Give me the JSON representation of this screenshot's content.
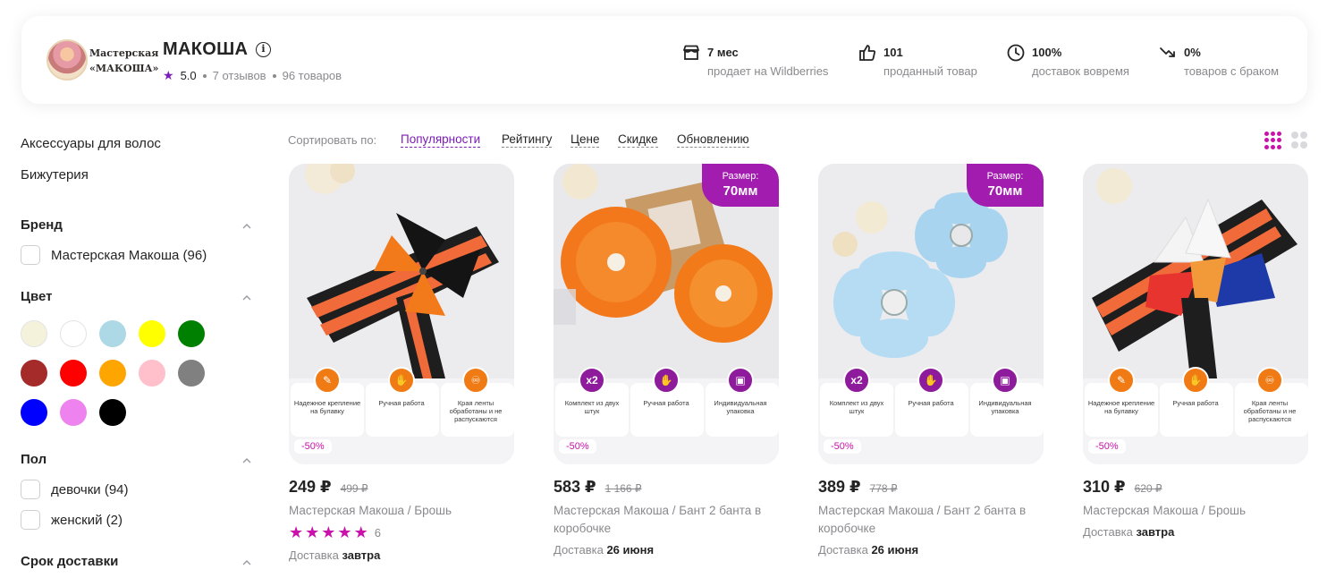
{
  "seller": {
    "logo_line1": "Мастерская",
    "logo_line2": "«МАКОША»",
    "name": "МАКОША",
    "info_glyph": "i",
    "rating": "5.0",
    "reviews": "7 отзывов",
    "products": "96 товаров",
    "stats": [
      {
        "icon": "store-icon",
        "value": "7 мес",
        "label": "продает на Wildberries"
      },
      {
        "icon": "thumbs-up-icon",
        "value": "101",
        "label": "проданный товар"
      },
      {
        "icon": "clock-icon",
        "value": "100%",
        "label": "доставок вовремя"
      },
      {
        "icon": "trend-down-icon",
        "value": "0%",
        "label": "товаров с браком"
      }
    ]
  },
  "sidebar": {
    "categories": [
      "Аксессуары для волос",
      "Бижутерия"
    ],
    "brand": {
      "title": "Бренд",
      "options": [
        {
          "label": "Мастерская Макоша (96)"
        }
      ]
    },
    "color": {
      "title": "Цвет",
      "swatches": [
        "#f5f2dc",
        "#ffffff",
        "#add8e6",
        "#ffff00",
        "#008000",
        "#a52a2a",
        "#ff0000",
        "#ffa500",
        "#ffc0cb",
        "#808080",
        "#0000ff",
        "#ee82ee",
        "#000000"
      ]
    },
    "gender": {
      "title": "Пол",
      "options": [
        {
          "label": "девочки (94)"
        },
        {
          "label": "женский (2)"
        }
      ]
    },
    "delivery": {
      "title": "Срок доставки"
    }
  },
  "sort": {
    "label": "Сортировать по:",
    "options": [
      "Популярности",
      "Рейтингу",
      "Цене",
      "Скидке",
      "Обновлению"
    ],
    "active": "Популярности"
  },
  "products": [
    {
      "price": "249 ₽",
      "old_price": "499 ₽",
      "discount": "-50%",
      "title": "Мастерская Макоша / Брошь",
      "rating_stars": 5,
      "rating_count": "6",
      "delivery_label": "Доставка",
      "delivery_value": "завтра",
      "features": [
        "Надежное крепление на булавку",
        "Ручная работа",
        "Края ленты обработаны и не распускаются"
      ],
      "feature_icons": [
        "pin-icon",
        "hand-icon",
        "ribbon-icon"
      ],
      "feature_color": "#f07b14"
    },
    {
      "price": "583 ₽",
      "old_price": "1 166 ₽",
      "discount": "-50%",
      "title": "Мастерская Макоша / Бант 2 банта в коробочке",
      "delivery_label": "Доставка",
      "delivery_value": "26 июня",
      "size_label": "Размер:",
      "size_value": "70мм",
      "features": [
        "Комплект из двух штук",
        "Ручная работа",
        "Индивидуальная упаковка"
      ],
      "feature_icons": [
        "x2-icon",
        "hand-icon",
        "box-icon"
      ],
      "feature_glyph": "x2",
      "feature_color": "#8e1a9c"
    },
    {
      "price": "389 ₽",
      "old_price": "778 ₽",
      "discount": "-50%",
      "title": "Мастерская Макоша / Бант 2 банта в коробочке",
      "delivery_label": "Доставка",
      "delivery_value": "26 июня",
      "size_label": "Размер:",
      "size_value": "70мм",
      "features": [
        "Комплект из двух штук",
        "Ручная работа",
        "Индивидуальная упаковка"
      ],
      "feature_icons": [
        "x2-icon",
        "hand-icon",
        "box-icon"
      ],
      "feature_glyph": "x2",
      "feature_color": "#8e1a9c"
    },
    {
      "price": "310 ₽",
      "old_price": "620 ₽",
      "discount": "-50%",
      "title": "Мастерская Макоша / Брошь",
      "delivery_label": "Доставка",
      "delivery_value": "завтра",
      "features": [
        "Надежное крепление на булавку",
        "Ручная работа",
        "Края ленты обработаны и не распускаются"
      ],
      "feature_icons": [
        "pin-icon",
        "hand-icon",
        "ribbon-icon"
      ],
      "feature_color": "#f07b14"
    }
  ]
}
